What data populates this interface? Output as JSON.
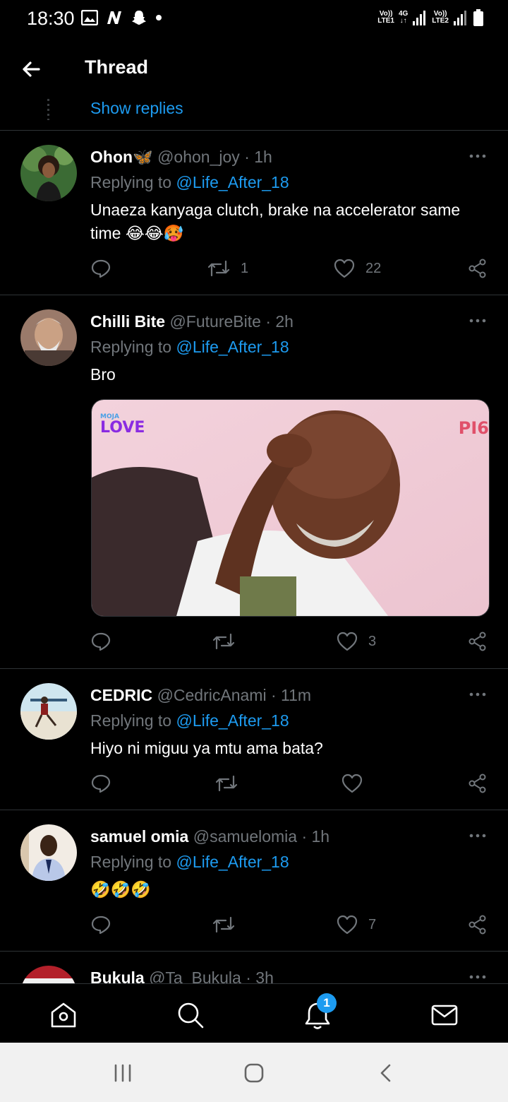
{
  "status_bar": {
    "time": "18:30",
    "left_icons": [
      "gallery-icon",
      "n-icon",
      "snapchat-icon",
      "dot-icon"
    ],
    "sim1_label_top": "Vo))",
    "sim1_label_bottom": "LTE1",
    "net_label": "4G",
    "sim2_label_top": "Vo))",
    "sim2_label_bottom": "LTE2"
  },
  "header": {
    "title": "Thread",
    "back_icon": "arrow-left-icon"
  },
  "show_replies": "Show replies",
  "tweets": [
    {
      "name": "Ohon🦋",
      "handle": "@ohon_joy",
      "time": "· 1h",
      "replying_prefix": "Replying to",
      "replying_to": "@Life_After_18",
      "text": "Unaeza kanyaga clutch, brake na accelerator same time 😂😂🥵",
      "retweets": "1",
      "likes": "22"
    },
    {
      "name": "Chilli Bite ",
      "handle": "@FutureBite",
      "time": "· 2h",
      "replying_prefix": "Replying to",
      "replying_to": "@Life_After_18",
      "text": "Bro",
      "media_logo_top": "MOJA",
      "media_logo_bottom": "LOVE",
      "media_corner": "PI6",
      "retweets": "",
      "likes": "3"
    },
    {
      "name": "CEDRIC",
      "handle": "@CedricAnami",
      "time": "· 11m",
      "replying_prefix": "Replying to",
      "replying_to": "@Life_After_18",
      "text": "Hiyo ni miguu ya mtu ama bata?",
      "retweets": "",
      "likes": ""
    },
    {
      "name": "samuel omia",
      "handle": "@samuelomia",
      "time": "· 1h",
      "replying_prefix": "Replying to",
      "replying_to": "@Life_After_18",
      "text": "🤣🤣🤣",
      "retweets": "",
      "likes": "7"
    },
    {
      "name": "Bukula",
      "handle": "@Ta_Bukula",
      "time": "· 3h"
    }
  ],
  "bottom_nav": {
    "items": [
      "home-icon",
      "search-icon",
      "notifications-icon",
      "messages-icon"
    ],
    "notification_badge": "1"
  },
  "colors": {
    "accent": "#1d9bf0",
    "muted": "#71767b",
    "divider": "#2f3336",
    "background": "#000000"
  }
}
